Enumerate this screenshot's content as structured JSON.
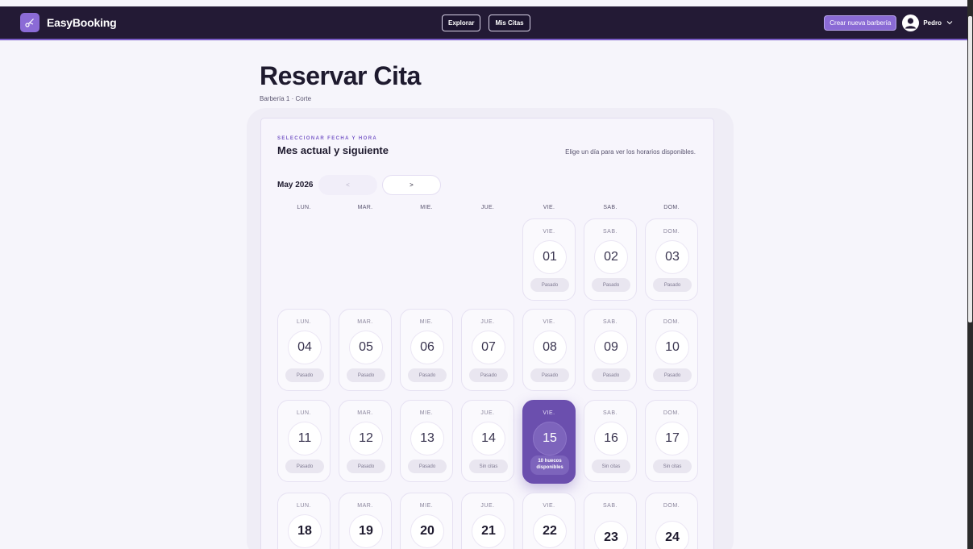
{
  "app": {
    "name": "EasyBooking"
  },
  "nav": {
    "explore_label": "Explorar",
    "appointments_label": "Mis Citas",
    "create_label": "Crear nueva barbería",
    "user_name": "Pedro"
  },
  "page": {
    "title": "Reservar Cita",
    "subtitle": "Barbería 1 · Corte"
  },
  "card": {
    "eyebrow": "SELECCIONAR FECHA Y HORA",
    "heading": "Mes actual y siguiente",
    "hint": "Elige un día para ver los horarios disponibles.",
    "month_label": "May 2026",
    "prev_label": "<",
    "next_label": ">"
  },
  "weekdays": [
    "LUN.",
    "MAR.",
    "MIE.",
    "JUE.",
    "VIE.",
    "SAB.",
    "DOM."
  ],
  "days": [
    {
      "name": "VIE.",
      "num": "01",
      "status": "Pasado"
    },
    {
      "name": "SAB.",
      "num": "02",
      "status": "Pasado"
    },
    {
      "name": "DOM.",
      "num": "03",
      "status": "Pasado"
    },
    {
      "name": "LUN.",
      "num": "04",
      "status": "Pasado"
    },
    {
      "name": "MAR.",
      "num": "05",
      "status": "Pasado"
    },
    {
      "name": "MIE.",
      "num": "06",
      "status": "Pasado"
    },
    {
      "name": "JUE.",
      "num": "07",
      "status": "Pasado"
    },
    {
      "name": "VIE.",
      "num": "08",
      "status": "Pasado"
    },
    {
      "name": "SAB.",
      "num": "09",
      "status": "Pasado"
    },
    {
      "name": "DOM.",
      "num": "10",
      "status": "Pasado"
    },
    {
      "name": "LUN.",
      "num": "11",
      "status": "Pasado"
    },
    {
      "name": "MAR.",
      "num": "12",
      "status": "Pasado"
    },
    {
      "name": "MIE.",
      "num": "13",
      "status": "Pasado"
    },
    {
      "name": "JUE.",
      "num": "14",
      "status": "Sin citas"
    },
    {
      "name": "VIE.",
      "num": "15",
      "status": "10 huecos disponibles",
      "selected": true
    },
    {
      "name": "SAB.",
      "num": "16",
      "status": "Sin citas"
    },
    {
      "name": "DOM.",
      "num": "17",
      "status": "Sin citas"
    },
    {
      "name": "LUN.",
      "num": "18",
      "status": ""
    },
    {
      "name": "MAR.",
      "num": "19",
      "status": ""
    },
    {
      "name": "MIE.",
      "num": "20",
      "status": ""
    },
    {
      "name": "JUE.",
      "num": "21",
      "status": ""
    },
    {
      "name": "VIE.",
      "num": "22",
      "status": ""
    },
    {
      "name": "SAB.",
      "num": "23",
      "status": ""
    },
    {
      "name": "DOM.",
      "num": "24",
      "status": ""
    }
  ],
  "colors": {
    "nav_bg": "#231a35",
    "accent": "#8a6ad5",
    "selected_day": "#6b4fae"
  }
}
